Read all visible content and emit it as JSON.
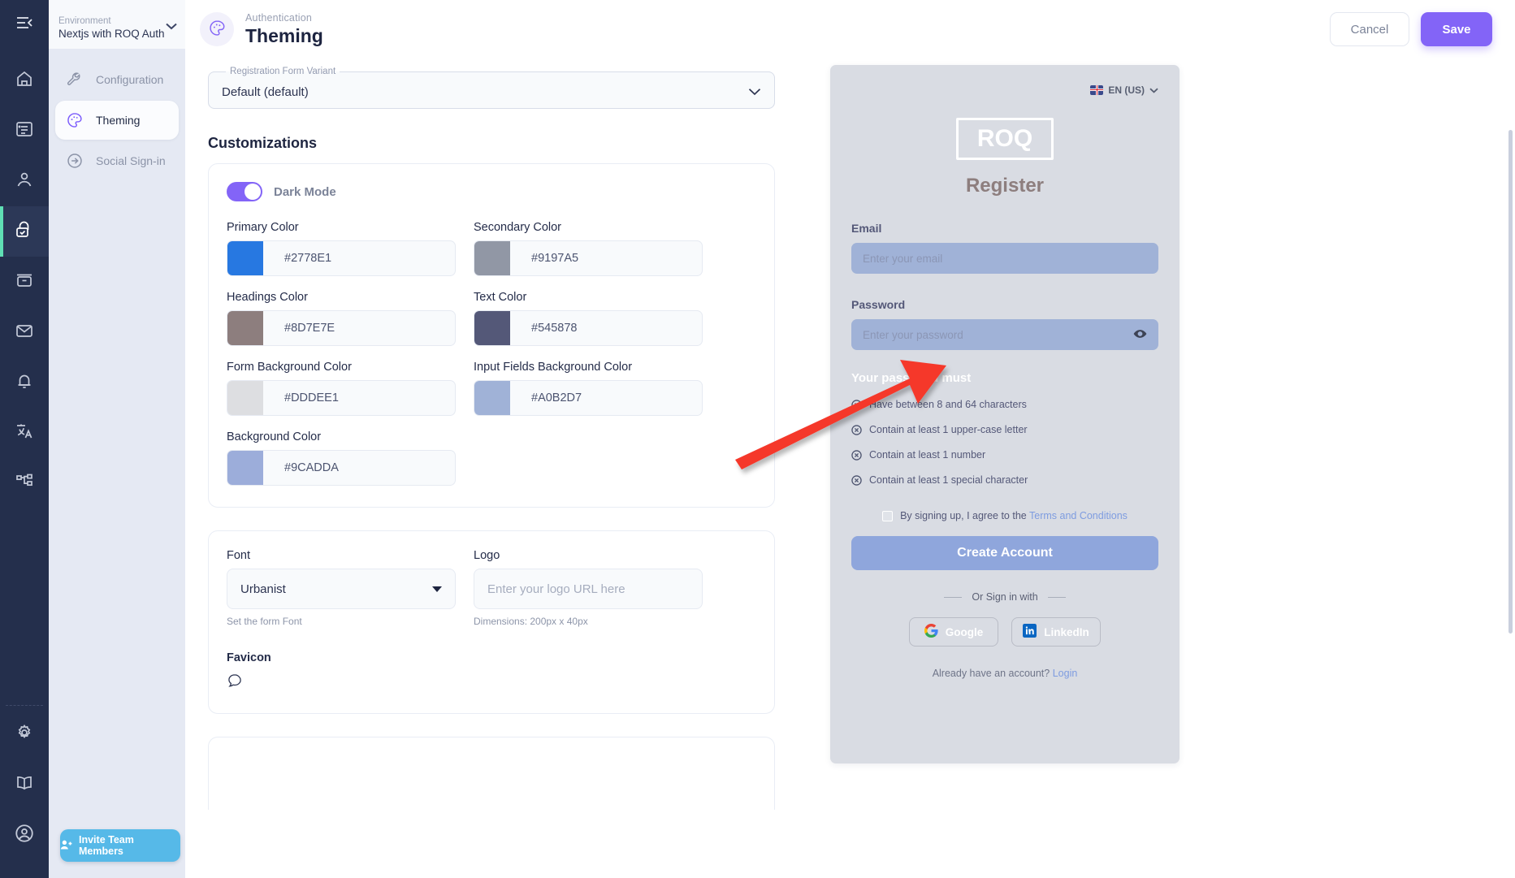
{
  "rail": {
    "collapse_icon": "menu-collapse-icon",
    "items": [
      {
        "icon": "home-icon",
        "name": "home"
      },
      {
        "icon": "list-icon",
        "name": "list"
      },
      {
        "icon": "user-icon",
        "name": "user"
      },
      {
        "icon": "lock-check-icon",
        "name": "authentication",
        "active": true
      },
      {
        "icon": "archive-icon",
        "name": "files"
      },
      {
        "icon": "mail-icon",
        "name": "mail"
      },
      {
        "icon": "bell-icon",
        "name": "notifications"
      },
      {
        "icon": "translate-icon",
        "name": "translations"
      },
      {
        "icon": "sitemap-icon",
        "name": "workflows"
      }
    ],
    "bottom_items": [
      {
        "icon": "gear-icon",
        "name": "settings"
      },
      {
        "icon": "book-icon",
        "name": "docs"
      },
      {
        "icon": "account-circle-icon",
        "name": "account"
      }
    ]
  },
  "sidebar": {
    "env_label": "Environment",
    "env_name": "Nextjs with ROQ Auth",
    "items": [
      {
        "label": "Configuration",
        "icon": "wrench-icon",
        "active": false
      },
      {
        "label": "Theming",
        "icon": "palette-icon",
        "active": true
      },
      {
        "label": "Social Sign-in",
        "icon": "arrow-right-circle-icon",
        "active": false
      }
    ],
    "invite_label": "Invite Team Members",
    "invite_icon": "user-plus-icon"
  },
  "header": {
    "eyebrow": "Authentication",
    "title": "Theming",
    "icon": "palette-icon",
    "cancel_label": "Cancel",
    "save_label": "Save"
  },
  "form": {
    "variant_legend": "Registration Form Variant",
    "variant_value": "Default (default)",
    "customizations_title": "Customizations",
    "dark_mode_label": "Dark Mode",
    "dark_mode_on": true,
    "colors": [
      {
        "label": "Primary Color",
        "value": "#2778E1"
      },
      {
        "label": "Secondary Color",
        "value": "#9197A5"
      },
      {
        "label": "Headings Color",
        "value": "#8D7E7E"
      },
      {
        "label": "Text Color",
        "value": "#545878"
      },
      {
        "label": "Form Background Color",
        "value": "#DDDEE1"
      },
      {
        "label": "Input Fields Background Color",
        "value": "#A0B2D7"
      },
      {
        "label": "Background Color",
        "value": "#9CADDA"
      }
    ],
    "font_label": "Font",
    "font_value": "Urbanist",
    "font_hint": "Set the form Font",
    "logo_label": "Logo",
    "logo_placeholder": "Enter your logo URL here",
    "logo_value": "",
    "logo_hint": "Dimensions: 200px x 40px",
    "favicon_label": "Favicon",
    "favicon_icon": "chat-bubble-icon"
  },
  "preview": {
    "language": "EN (US)",
    "language_flag_icon": "uk-flag-icon",
    "chevron_icon": "chevron-down-icon",
    "logo_text": "ROQ",
    "title": "Register",
    "email_label": "Email",
    "email_placeholder": "Enter your email",
    "password_label": "Password",
    "password_placeholder": "Enter your password",
    "eye_icon": "eye-icon",
    "password_rules_title": "Your password must",
    "password_rules": [
      "Have between 8 and 64 characters",
      "Contain at least 1 upper-case letter",
      "Contain at least 1 number",
      "Contain at least 1 special character"
    ],
    "terms_prefix": "By signing up, I agree to the",
    "terms_link": "Terms and Conditions",
    "create_label": "Create Account",
    "or_label": "Or Sign in with",
    "socials": [
      {
        "name": "Google",
        "icon": "google-icon"
      },
      {
        "name": "LinkedIn",
        "icon": "linkedin-icon"
      }
    ],
    "already_text": "Already have an account?",
    "login_link": "Login"
  },
  "annotation": {
    "arrow_color": "#f5372c"
  }
}
